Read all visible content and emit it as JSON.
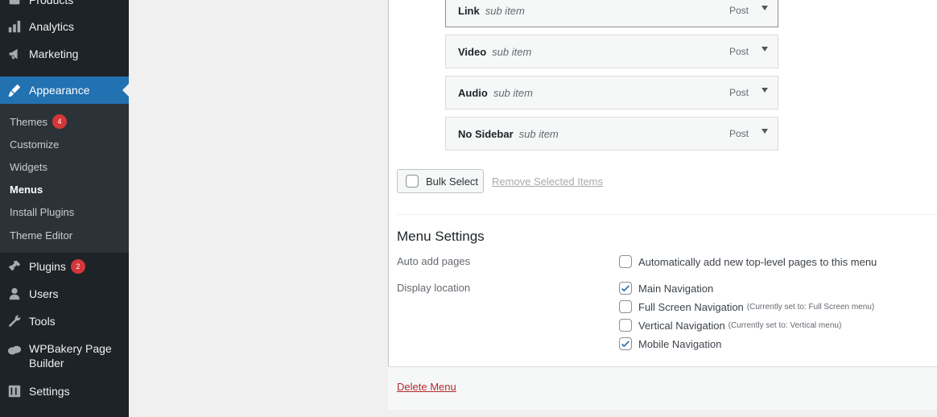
{
  "sidebar": {
    "items": [
      {
        "label": "Products",
        "icon": "products-icon"
      },
      {
        "label": "Analytics",
        "icon": "analytics-icon"
      },
      {
        "label": "Marketing",
        "icon": "marketing-icon"
      },
      {
        "label": "Appearance",
        "icon": "appearance-icon"
      },
      {
        "label": "Plugins",
        "icon": "plugins-icon",
        "badge": "2"
      },
      {
        "label": "Users",
        "icon": "users-icon"
      },
      {
        "label": "Tools",
        "icon": "tools-icon"
      },
      {
        "label": "WPBakery Page Builder",
        "icon": "wpbakery-icon"
      },
      {
        "label": "Settings",
        "icon": "settings-icon"
      }
    ],
    "submenu": [
      {
        "label": "Themes",
        "badge": "4"
      },
      {
        "label": "Customize"
      },
      {
        "label": "Widgets"
      },
      {
        "label": "Menus"
      },
      {
        "label": "Install Plugins"
      },
      {
        "label": "Theme Editor"
      }
    ]
  },
  "menu_items": [
    {
      "title": "Link",
      "subtag": "sub item",
      "type": "Post"
    },
    {
      "title": "Video",
      "subtag": "sub item",
      "type": "Post"
    },
    {
      "title": "Audio",
      "subtag": "sub item",
      "type": "Post"
    },
    {
      "title": "No Sidebar",
      "subtag": "sub item",
      "type": "Post"
    }
  ],
  "bulk": {
    "select_label": "Bulk Select",
    "remove_label": "Remove Selected Items"
  },
  "settings": {
    "title": "Menu Settings",
    "auto_add_label": "Auto add pages",
    "auto_add_option": {
      "label": "Automatically add new top-level pages to this menu",
      "checked": false
    },
    "display_location_label": "Display location",
    "locations": [
      {
        "label": "Main Navigation",
        "note": "",
        "checked": true
      },
      {
        "label": "Full Screen Navigation",
        "note": "(Currently set to: Full Screen menu)",
        "checked": false
      },
      {
        "label": "Vertical Navigation",
        "note": "(Currently set to: Vertical menu)",
        "checked": false
      },
      {
        "label": "Mobile Navigation",
        "note": "",
        "checked": true
      }
    ]
  },
  "footer": {
    "delete_label": "Delete Menu"
  },
  "colors": {
    "sidebar_bg": "#1d2327",
    "accent": "#2271b1",
    "badge": "#d63638",
    "delete": "#b32d2e"
  }
}
